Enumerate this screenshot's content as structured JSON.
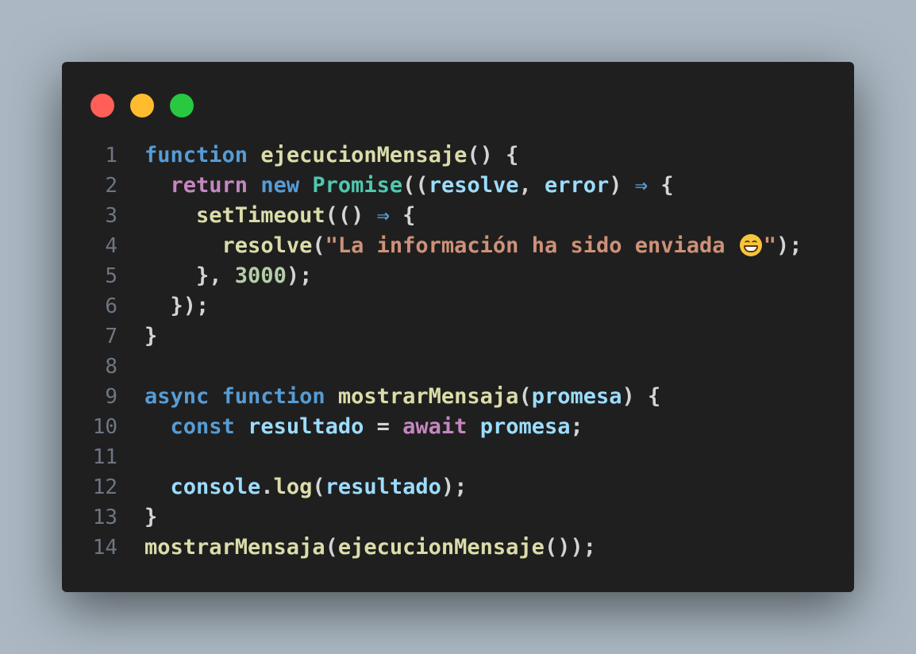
{
  "window": {
    "background": "#1f1f1f",
    "page_background": "#abb8c3",
    "traffic_lights": [
      {
        "name": "close",
        "color": "#ff5f57"
      },
      {
        "name": "minimize",
        "color": "#febc2e"
      },
      {
        "name": "maximize",
        "color": "#28c840"
      }
    ]
  },
  "colors": {
    "kw": "#569cd6",
    "ctrl": "#c586c0",
    "fn": "#dcdcaa",
    "cls": "#4ec9b0",
    "var": "#9cdcfe",
    "str": "#ce9178",
    "num": "#b5cea8",
    "punc": "#d4d4d4",
    "op": "#d4d4d4",
    "arrow": "#569cd6"
  },
  "code": {
    "lines": [
      {
        "n": "1",
        "tokens": [
          {
            "t": "function",
            "c": "kw"
          },
          {
            "t": " ",
            "c": "punc"
          },
          {
            "t": "ejecucionMensaje",
            "c": "fn"
          },
          {
            "t": "() {",
            "c": "punc"
          }
        ]
      },
      {
        "n": "2",
        "tokens": [
          {
            "t": "  ",
            "c": "punc"
          },
          {
            "t": "return",
            "c": "ctrl"
          },
          {
            "t": " ",
            "c": "punc"
          },
          {
            "t": "new",
            "c": "kw"
          },
          {
            "t": " ",
            "c": "punc"
          },
          {
            "t": "Promise",
            "c": "cls"
          },
          {
            "t": "((",
            "c": "punc"
          },
          {
            "t": "resolve",
            "c": "var"
          },
          {
            "t": ", ",
            "c": "punc"
          },
          {
            "t": "error",
            "c": "var"
          },
          {
            "t": ") ",
            "c": "punc"
          },
          {
            "t": "⇒",
            "c": "arrow"
          },
          {
            "t": " {",
            "c": "punc"
          }
        ]
      },
      {
        "n": "3",
        "tokens": [
          {
            "t": "    ",
            "c": "punc"
          },
          {
            "t": "setTimeout",
            "c": "fn"
          },
          {
            "t": "(() ",
            "c": "punc"
          },
          {
            "t": "⇒",
            "c": "arrow"
          },
          {
            "t": " {",
            "c": "punc"
          }
        ]
      },
      {
        "n": "4",
        "tokens": [
          {
            "t": "      ",
            "c": "punc"
          },
          {
            "t": "resolve",
            "c": "fn"
          },
          {
            "t": "(",
            "c": "punc"
          },
          {
            "t": "\"La información ha sido enviada ",
            "c": "str"
          },
          {
            "t": "😄",
            "c": "emoji"
          },
          {
            "t": "\"",
            "c": "str"
          },
          {
            "t": ");",
            "c": "punc"
          }
        ]
      },
      {
        "n": "5",
        "tokens": [
          {
            "t": "    }, ",
            "c": "punc"
          },
          {
            "t": "3000",
            "c": "num"
          },
          {
            "t": ");",
            "c": "punc"
          }
        ]
      },
      {
        "n": "6",
        "tokens": [
          {
            "t": "  });",
            "c": "punc"
          }
        ]
      },
      {
        "n": "7",
        "tokens": [
          {
            "t": "}",
            "c": "punc"
          }
        ]
      },
      {
        "n": "8",
        "tokens": []
      },
      {
        "n": "9",
        "tokens": [
          {
            "t": "async",
            "c": "kw"
          },
          {
            "t": " ",
            "c": "punc"
          },
          {
            "t": "function",
            "c": "kw"
          },
          {
            "t": " ",
            "c": "punc"
          },
          {
            "t": "mostrarMensaja",
            "c": "fn"
          },
          {
            "t": "(",
            "c": "punc"
          },
          {
            "t": "promesa",
            "c": "var"
          },
          {
            "t": ") {",
            "c": "punc"
          }
        ]
      },
      {
        "n": "10",
        "tokens": [
          {
            "t": "  ",
            "c": "punc"
          },
          {
            "t": "const",
            "c": "kw"
          },
          {
            "t": " ",
            "c": "punc"
          },
          {
            "t": "resultado",
            "c": "var"
          },
          {
            "t": " = ",
            "c": "op"
          },
          {
            "t": "await",
            "c": "ctrl"
          },
          {
            "t": " ",
            "c": "punc"
          },
          {
            "t": "promesa",
            "c": "var"
          },
          {
            "t": ";",
            "c": "punc"
          }
        ]
      },
      {
        "n": "11",
        "tokens": []
      },
      {
        "n": "12",
        "tokens": [
          {
            "t": "  ",
            "c": "punc"
          },
          {
            "t": "console",
            "c": "var"
          },
          {
            "t": ".",
            "c": "punc"
          },
          {
            "t": "log",
            "c": "fn"
          },
          {
            "t": "(",
            "c": "punc"
          },
          {
            "t": "resultado",
            "c": "var"
          },
          {
            "t": ");",
            "c": "punc"
          }
        ]
      },
      {
        "n": "13",
        "tokens": [
          {
            "t": "}",
            "c": "punc"
          }
        ]
      },
      {
        "n": "14",
        "tokens": [
          {
            "t": "mostrarMensaja",
            "c": "fn"
          },
          {
            "t": "(",
            "c": "punc"
          },
          {
            "t": "ejecucionMensaje",
            "c": "fn"
          },
          {
            "t": "());",
            "c": "punc"
          }
        ]
      }
    ]
  }
}
